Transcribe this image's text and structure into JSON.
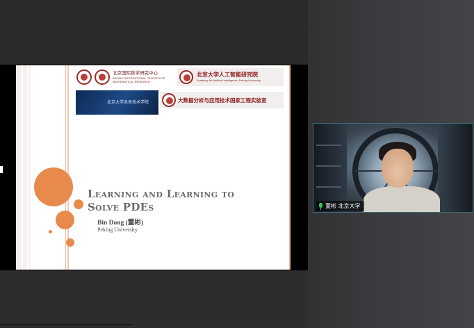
{
  "slide": {
    "title_line1": "Learning and Learning to",
    "title_line2": "Solve PDEs",
    "author": "Bin Dong (董彬)",
    "affiliation": "Peking University"
  },
  "logos": {
    "bicmr_cn": "北京国际数学研究中心",
    "bicmr_en1": "BEIJING INTERNATIONAL CENTER FOR",
    "bicmr_en2": "MATHEMATICAL RESEARCH",
    "aiar_cn": "北京大学人工智能研究院",
    "aiar_en": "Academy for Artificial Intelligence, Peking University",
    "blue_logo_cn": "北京大学未来技术学院",
    "bigdata_lab_cn": "大数据分析与应用技术国家工程实验室"
  },
  "video": {
    "participant_name": "董彬 北京大学",
    "mic_icon": "microphone-icon",
    "mic_color": "#36c25a"
  },
  "colors": {
    "accent_orange": "#e98a4d",
    "logo_red": "#8d1e1a"
  }
}
